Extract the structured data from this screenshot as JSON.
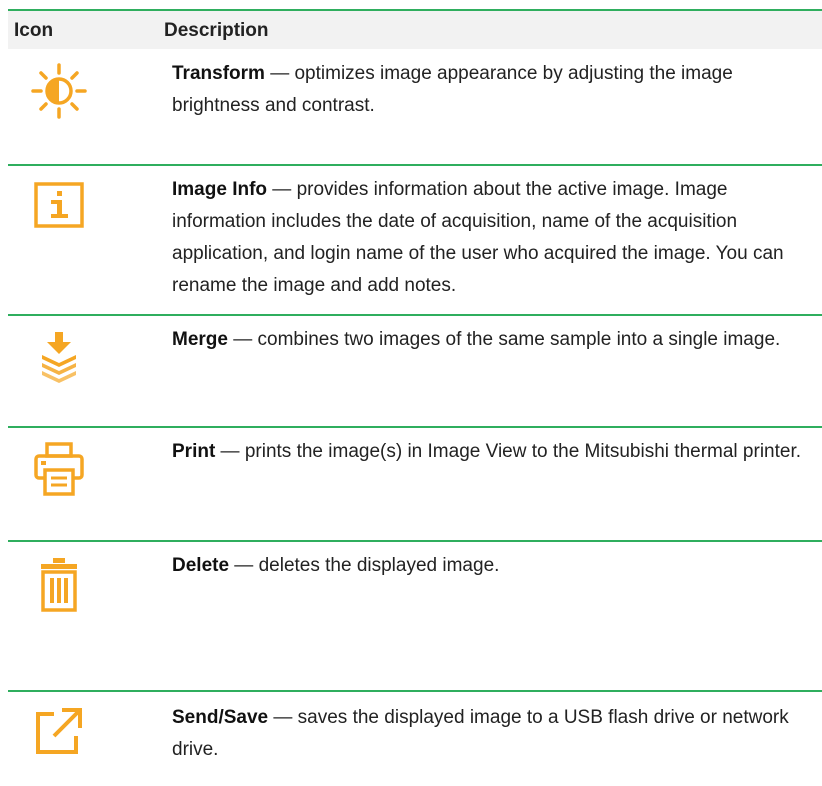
{
  "table": {
    "headers": {
      "icon": "Icon",
      "description": "Description"
    },
    "rows": [
      {
        "icon": "brightness-contrast-icon",
        "term": "Transform",
        "sep": " — ",
        "text": "optimizes image appearance by adjusting the image brightness and contrast."
      },
      {
        "icon": "info-icon",
        "term": "Image Info",
        "sep": " — ",
        "text": "provides information about the active image. Image information includes the date of acquisition, name of the acquisition application, and login name of the user who acquired the image. You can rename the image and add notes."
      },
      {
        "icon": "merge-layers-icon",
        "term": "Merge",
        "sep": " — ",
        "text": "combines two images of the same sample into a single image."
      },
      {
        "icon": "printer-icon",
        "term": "Print",
        "sep": " — ",
        "text": "prints the image(s) in Image View to the Mitsubishi thermal printer."
      },
      {
        "icon": "trash-icon",
        "term": "Delete",
        "sep": " — ",
        "text": "deletes the displayed image."
      },
      {
        "icon": "export-icon",
        "term": "Send/Save",
        "sep": " — ",
        "text": "saves the displayed image to a USB flash drive or network drive."
      }
    ]
  },
  "colors": {
    "accent_rule": "#2fae5e",
    "icon": "#f5a623",
    "header_bg": "#f2f2f2"
  }
}
